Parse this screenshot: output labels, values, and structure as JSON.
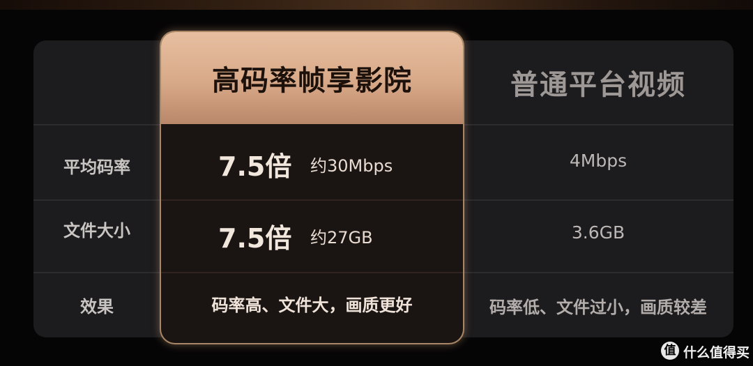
{
  "columns": {
    "highlight": "高码率帧享影院",
    "normal": "普通平台视频"
  },
  "rows": [
    {
      "label": "平均码率",
      "highlight_multiplier": "7.5倍",
      "highlight_value": "约30Mbps",
      "normal_value": "4Mbps"
    },
    {
      "label": "文件大小",
      "highlight_multiplier": "7.5倍",
      "highlight_value": "约27GB",
      "normal_value": "3.6GB"
    },
    {
      "label": "效果",
      "highlight_value": "码率高、文件大，画质更好",
      "normal_value": "码率低、文件过小，画质较差"
    }
  ],
  "watermark": {
    "icon_text": "值",
    "text": "什么值得买"
  },
  "colors": {
    "background": "#060506",
    "table": "#1c1b1d",
    "highlight_header": "#d8a988",
    "highlight_text": "#f2e7dd",
    "normal_text": "#bdb8b6"
  }
}
